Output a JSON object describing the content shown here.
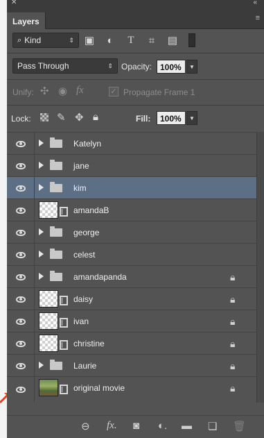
{
  "panel": {
    "tab_label": "Layers",
    "filter": {
      "kind_label": "Kind"
    },
    "blend_mode": "Pass Through",
    "opacity_label": "Opacity:",
    "opacity_value": "100%",
    "unify_label": "Unify:",
    "propagate_label": "Propagate Frame 1",
    "lock_label": "Lock:",
    "fill_label": "Fill:",
    "fill_value": "100%"
  },
  "layers": [
    {
      "name": "Katelyn",
      "type": "group",
      "locked": false,
      "selected": false
    },
    {
      "name": "jane",
      "type": "group",
      "locked": false,
      "selected": false
    },
    {
      "name": "kim",
      "type": "group",
      "locked": false,
      "selected": true
    },
    {
      "name": "amandaB",
      "type": "video",
      "locked": false,
      "selected": false
    },
    {
      "name": "george",
      "type": "group",
      "locked": false,
      "selected": false
    },
    {
      "name": "celest",
      "type": "group",
      "locked": false,
      "selected": false
    },
    {
      "name": "amandapanda",
      "type": "group",
      "locked": true,
      "selected": false
    },
    {
      "name": "daisy",
      "type": "video",
      "locked": true,
      "selected": false
    },
    {
      "name": "ivan",
      "type": "video",
      "locked": true,
      "selected": false
    },
    {
      "name": "christine",
      "type": "video",
      "locked": true,
      "selected": false
    },
    {
      "name": "Laurie",
      "type": "group",
      "locked": true,
      "selected": false
    },
    {
      "name": "original movie",
      "type": "photo",
      "locked": true,
      "selected": false
    }
  ],
  "colors": {
    "panel_bg": "#535353",
    "selected_row": "#5c6f85",
    "annotation_arrow": "#e8401c"
  }
}
